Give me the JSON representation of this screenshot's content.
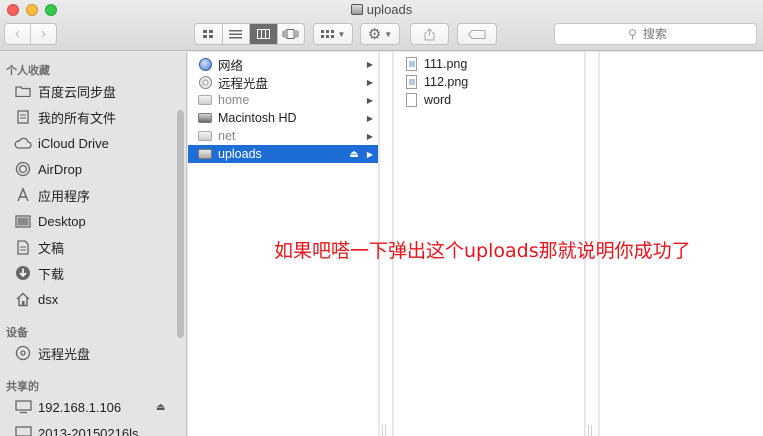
{
  "window": {
    "title": "uploads"
  },
  "toolbar": {
    "back_icon": "chevron-left-icon",
    "forward_icon": "chevron-right-icon",
    "view_modes": [
      "icon-view",
      "list-view",
      "column-view",
      "coverflow-view"
    ],
    "active_view": "column-view",
    "search_placeholder": "搜索"
  },
  "sidebar": {
    "favorites_header": "个人收藏",
    "favorites": [
      {
        "label": "百度云同步盘",
        "icon": "folder-icon"
      },
      {
        "label": "我的所有文件",
        "icon": "all-files-icon"
      },
      {
        "label": "iCloud Drive",
        "icon": "cloud-icon"
      },
      {
        "label": "AirDrop",
        "icon": "airdrop-icon"
      },
      {
        "label": "应用程序",
        "icon": "applications-icon"
      },
      {
        "label": "Desktop",
        "icon": "desktop-icon"
      },
      {
        "label": "文稿",
        "icon": "documents-icon"
      },
      {
        "label": "下载",
        "icon": "download-icon"
      },
      {
        "label": "dsx",
        "icon": "home-icon"
      }
    ],
    "devices_header": "设备",
    "devices": [
      {
        "label": "远程光盘",
        "icon": "disc-icon"
      }
    ],
    "shared_header": "共享的",
    "shared": [
      {
        "label": "192.168.1.106",
        "icon": "monitor-icon"
      },
      {
        "label": "2013-20150216ls",
        "icon": "monitor-icon"
      }
    ]
  },
  "column1": [
    {
      "label": "网络",
      "icon": "globe-icon"
    },
    {
      "label": "远程光盘",
      "icon": "disc-icon"
    },
    {
      "label": "home",
      "icon": "drive-icon"
    },
    {
      "label": "Macintosh HD",
      "icon": "drive-icon"
    },
    {
      "label": "net",
      "icon": "drive-icon"
    },
    {
      "label": "uploads",
      "icon": "drive-icon"
    }
  ],
  "column2": [
    {
      "label": "111.png",
      "icon": "image-file-icon"
    },
    {
      "label": "112.png",
      "icon": "image-file-icon"
    },
    {
      "label": "word",
      "icon": "file-icon"
    }
  ],
  "annotation": "如果吧嗒一下弹出这个uploads那就说明你成功了",
  "colors": {
    "selection": "#1e6cd6",
    "annotation": "#e8141c"
  }
}
